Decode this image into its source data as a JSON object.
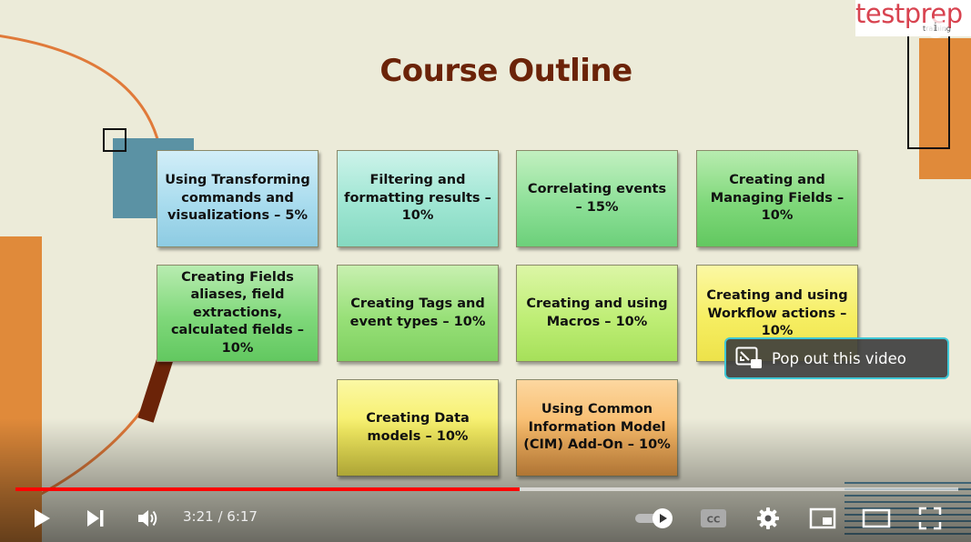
{
  "slide": {
    "title": "Course Outline",
    "colors": {
      "title": "#6b2308",
      "accent_orange": "#e08a3a",
      "accent_brown": "#6b2308"
    },
    "cards": [
      {
        "text": "Using Transforming commands and visualizations – 5%",
        "color": "blue"
      },
      {
        "text": "Filtering and formatting results – 10%",
        "color": "teal"
      },
      {
        "text": "Correlating events – 15%",
        "color": "green"
      },
      {
        "text": "Creating and Managing Fields – 10%",
        "color": "green"
      },
      {
        "text": "Creating Fields aliases, field extractions, calculated fields – 10%",
        "color": "green"
      },
      {
        "text": "Creating Tags and event types – 10%",
        "color": "green"
      },
      {
        "text": "Creating and using Macros – 10%",
        "color": "lime"
      },
      {
        "text": "Creating and using Workflow actions – 10%",
        "color": "yellow"
      },
      {
        "text": "Creating Data models – 10%",
        "color": "yellow"
      },
      {
        "text": "Using Common Information Model (CIM) Add-On – 10%",
        "color": "orange"
      }
    ]
  },
  "watermark": {
    "brand": "testprep",
    "sub": "training",
    "icon": "info-icon"
  },
  "popout": {
    "label": "Pop out this video",
    "icon": "popout-icon",
    "border_color": "#3ec7d6"
  },
  "player": {
    "current_time": "3:21",
    "duration": "6:17",
    "time_display": "3:21 / 6:17",
    "progress_fraction": 0.535,
    "buffered_fraction": 1.0,
    "progress_color": "#ff0000",
    "autoplay": "on",
    "controls": [
      "play-icon",
      "next-icon",
      "volume-icon",
      "autoplay-toggle",
      "captions-icon",
      "settings-icon",
      "miniplayer-icon",
      "theater-icon",
      "fullscreen-icon"
    ]
  }
}
